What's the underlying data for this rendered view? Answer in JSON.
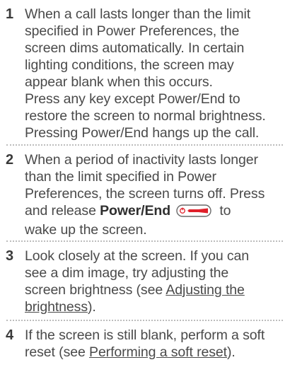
{
  "steps": [
    {
      "number": "1",
      "lines": [
        "When a call lasts longer than the limit",
        "specified in Power Preferences, the",
        "screen dims automatically. In certain",
        "lighting conditions, the screen may",
        "appear blank when this occurs.",
        "Press any key except Power/End to",
        "restore the screen to normal brightness.",
        "Pressing Power/End hangs up the call."
      ]
    },
    {
      "number": "2",
      "lines": [
        "When a period of inactivity lasts longer",
        "than the limit specified in Power",
        "Preferences, the screen turns off. Press"
      ],
      "line4_pre": "and release ",
      "line4_bold": "Power/End",
      "line4_post": " to",
      "line5": "wake up the screen."
    },
    {
      "number": "3",
      "lines": [
        "Look closely at the screen. If you can",
        "see a dim image, try adjusting the"
      ],
      "line3_pre": "screen brightness (see ",
      "line3_link": "Adjusting the ",
      "line4_link": "brightness",
      "line4_post": ")."
    },
    {
      "number": "4",
      "line1": "If the screen is still blank, perform a soft",
      "line2_pre": "reset (see ",
      "line2_link": "Performing a soft reset",
      "line2_post": ")."
    }
  ],
  "icons": {
    "power_end_key": "power-end-key-icon",
    "accent_color": "#e0202a"
  }
}
